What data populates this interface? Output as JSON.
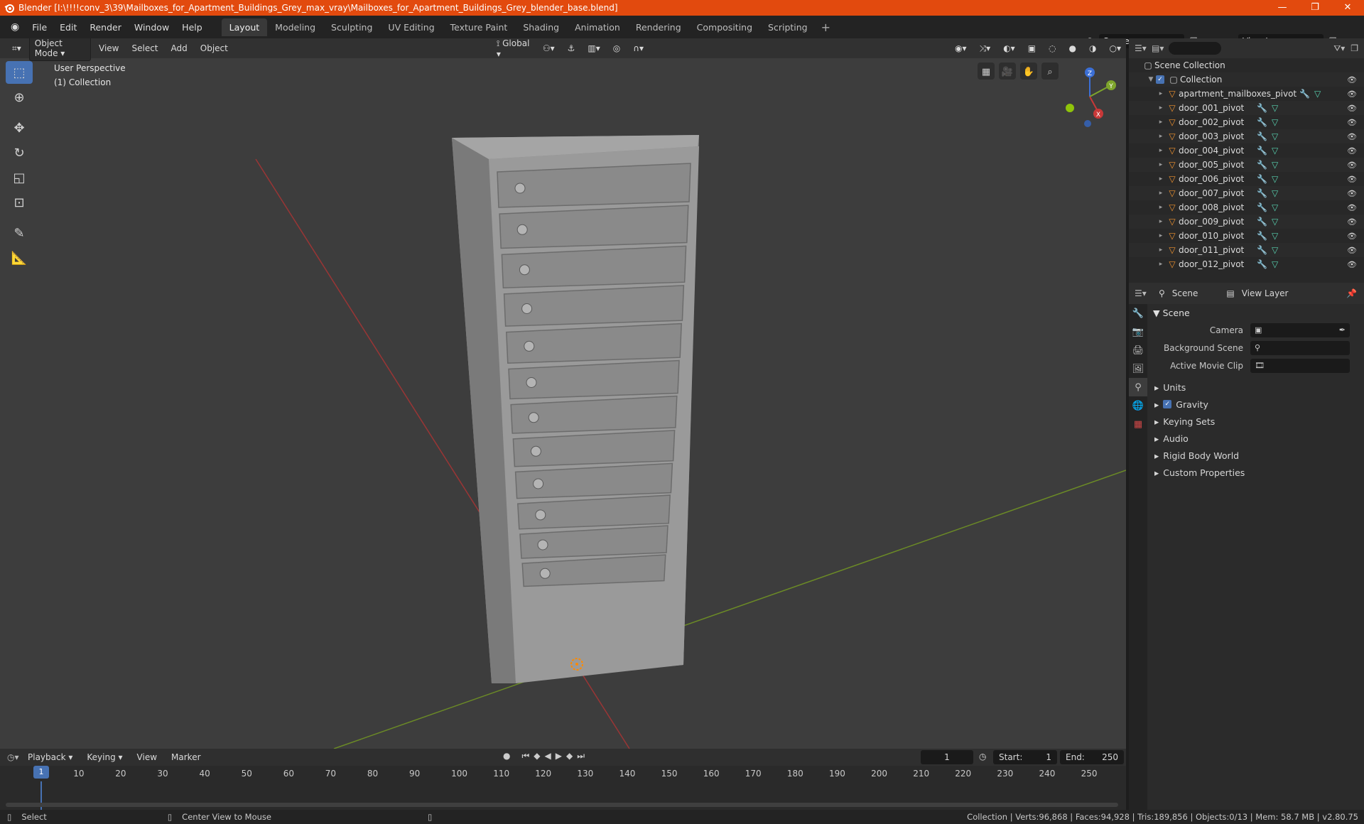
{
  "window": {
    "title": "Blender [I:\\!!!!conv_3\\39\\Mailboxes_for_Apartment_Buildings_Grey_max_vray\\Mailboxes_for_Apartment_Buildings_Grey_blender_base.blend]",
    "minimize": "—",
    "restore": "❐",
    "close": "✕"
  },
  "menu": [
    "File",
    "Edit",
    "Render",
    "Window",
    "Help"
  ],
  "workspaces": [
    "Layout",
    "Modeling",
    "Sculpting",
    "UV Editing",
    "Texture Paint",
    "Shading",
    "Animation",
    "Rendering",
    "Compositing",
    "Scripting"
  ],
  "active_workspace": 0,
  "scene_name": "Scene",
  "view_layer_name": "View Layer",
  "viewport": {
    "mode": "Object Mode",
    "menus": [
      "View",
      "Select",
      "Add",
      "Object"
    ],
    "transform": "Global",
    "info_line1": "User Perspective",
    "info_line2": "(1) Collection",
    "axis_x": "X",
    "axis_y": "Y",
    "axis_z": "Z"
  },
  "outliner": {
    "root": "Scene Collection",
    "collection": "Collection",
    "objects": [
      "apartment_mailboxes_pivot",
      "door_001_pivot",
      "door_002_pivot",
      "door_003_pivot",
      "door_004_pivot",
      "door_005_pivot",
      "door_006_pivot",
      "door_007_pivot",
      "door_008_pivot",
      "door_009_pivot",
      "door_010_pivot",
      "door_011_pivot",
      "door_012_pivot"
    ]
  },
  "properties": {
    "tab_scene": "Scene",
    "tab_viewlayer": "View Layer",
    "section": "Scene",
    "camera_label": "Camera",
    "bg_scene_label": "Background Scene",
    "movie_clip_label": "Active Movie Clip",
    "subsections": [
      "Units",
      "Gravity",
      "Keying Sets",
      "Audio",
      "Rigid Body World",
      "Custom Properties"
    ]
  },
  "timeline": {
    "menus": [
      "Playback",
      "Keying",
      "View",
      "Marker"
    ],
    "current_frame": "1",
    "start_label": "Start:",
    "start": "1",
    "end_label": "End:",
    "end": "250",
    "ticks": [
      "10",
      "20",
      "30",
      "40",
      "50",
      "60",
      "70",
      "80",
      "90",
      "100",
      "110",
      "120",
      "130",
      "140",
      "150",
      "160",
      "170",
      "180",
      "190",
      "200",
      "210",
      "220",
      "230",
      "240",
      "250"
    ]
  },
  "status": {
    "left": "Select",
    "middle": "Center View to Mouse",
    "right": "Collection | Verts:96,868 | Faces:94,928 | Tris:189,856 | Objects:0/13 | Mem: 58.7 MB | v2.80.75"
  },
  "colors": {
    "accent": "#4772b3",
    "title": "#e24a0e",
    "x_axis": "#c83838",
    "y_axis": "#7ea52c"
  }
}
